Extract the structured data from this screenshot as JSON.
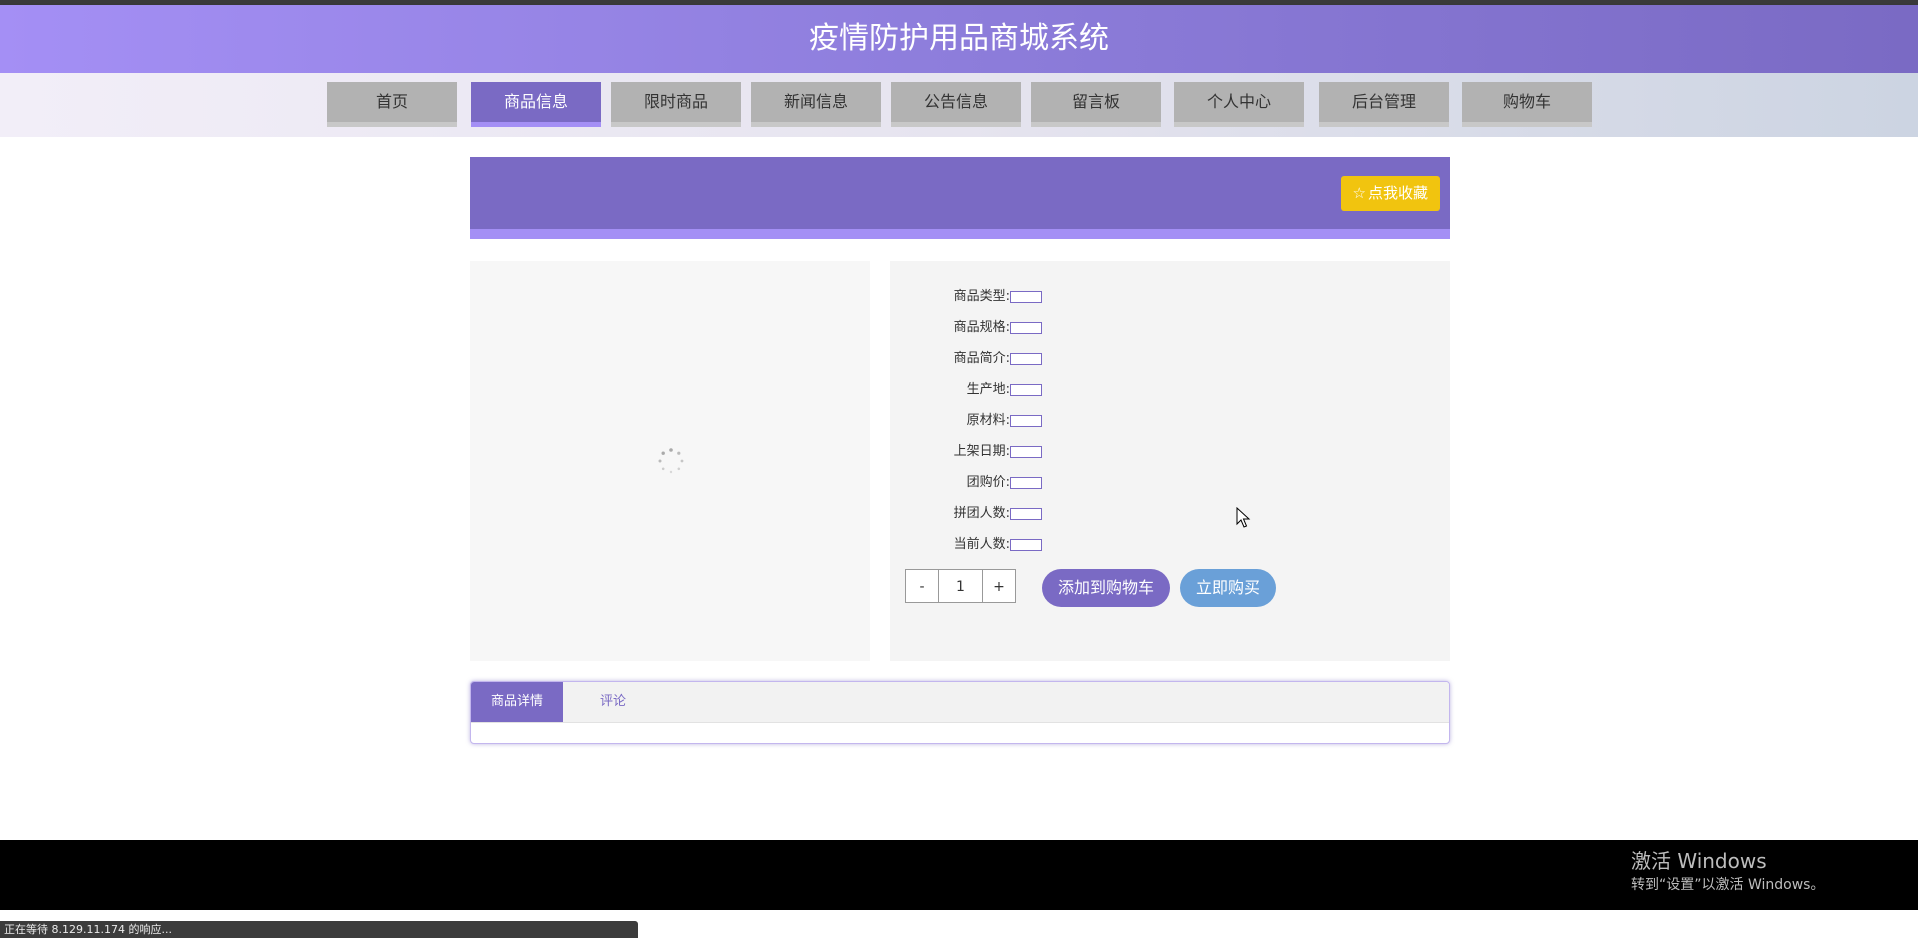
{
  "header": {
    "title": "疫情防护用品商城系统"
  },
  "nav": {
    "items": [
      {
        "label": "首页"
      },
      {
        "label": "商品信息"
      },
      {
        "label": "限时商品"
      },
      {
        "label": "新闻信息"
      },
      {
        "label": "公告信息"
      },
      {
        "label": "留言板"
      },
      {
        "label": "个人中心"
      },
      {
        "label": "后台管理"
      },
      {
        "label": "购物车"
      }
    ],
    "active": "商品信息"
  },
  "banner": {
    "favorite_label": "点我收藏",
    "favorite_icon": "star-outline-icon"
  },
  "product": {
    "fields": [
      {
        "label": "商品类型:",
        "value": ""
      },
      {
        "label": "商品规格:",
        "value": ""
      },
      {
        "label": "商品简介:",
        "value": ""
      },
      {
        "label": "生产地:",
        "value": ""
      },
      {
        "label": "原材料:",
        "value": ""
      },
      {
        "label": "上架日期:",
        "value": ""
      },
      {
        "label": "团购价:",
        "value": ""
      },
      {
        "label": "拼团人数:",
        "value": ""
      },
      {
        "label": "当前人数:",
        "value": ""
      }
    ],
    "quantity": {
      "minus": "-",
      "value": "1",
      "plus": "+"
    },
    "add_to_cart_label": "添加到购物车",
    "buy_now_label": "立即购买",
    "image_state": "loading"
  },
  "tabs": [
    {
      "label": "商品详情",
      "active": true
    },
    {
      "label": "评论",
      "active": false
    }
  ],
  "watermark": {
    "title": "激活 Windows",
    "subtitle": "转到“设置”以激活 Windows。"
  },
  "status_bar": {
    "text": "正在等待 8.129.11.174 的响应..."
  },
  "colors": {
    "primary": "#7a6ac4",
    "primary_light": "#a48ff5",
    "favorite": "#f1c40f",
    "buy": "#6aa0d8"
  }
}
